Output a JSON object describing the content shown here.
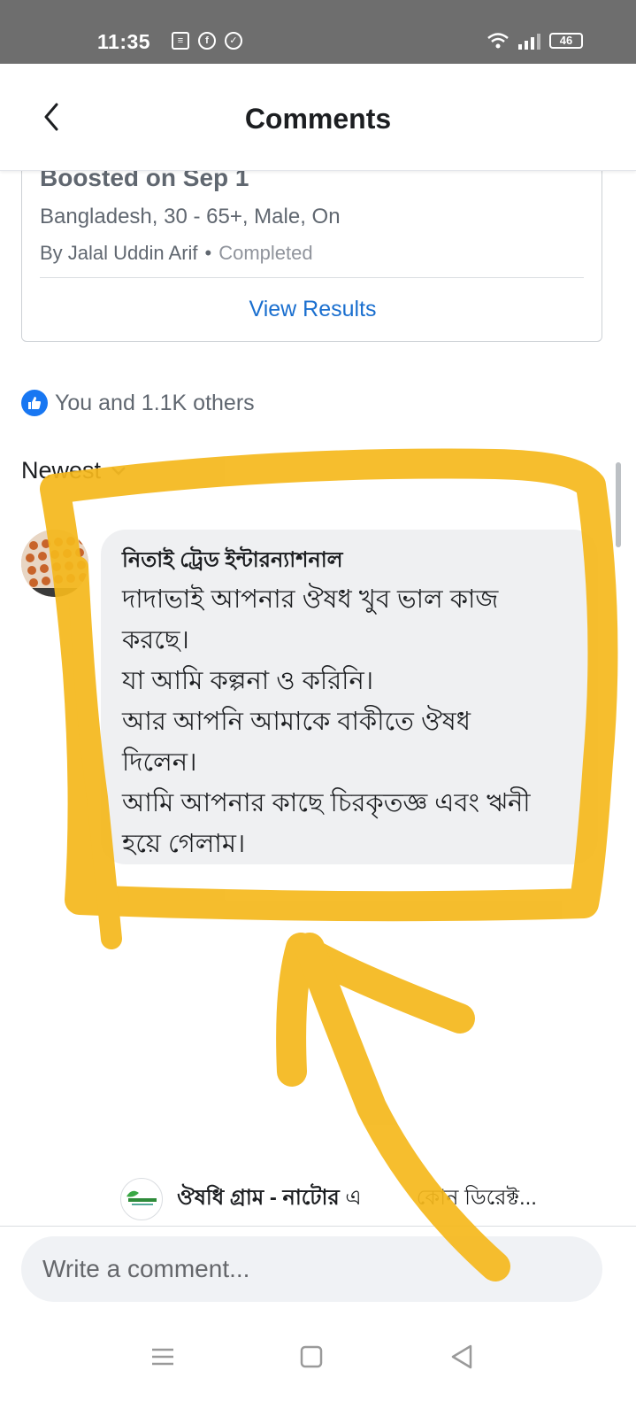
{
  "status_bar": {
    "time": "11:35",
    "battery": "46"
  },
  "header": {
    "title": "Comments"
  },
  "boost": {
    "title": "Boosted on Sep 1",
    "audience": "Bangladesh, 30 - 65+, Male, On",
    "author": "By Jalal Uddin Arif",
    "separator": "•",
    "status": "Completed",
    "action": "View Results"
  },
  "reactions": {
    "summary": "You and 1.1K others"
  },
  "sort": {
    "label": "Newest"
  },
  "comment": {
    "author": "নিতাই ট্রেড ইন্টারন্যাশনাল",
    "text": "দাদাভাই আপনার ঔষধ খুব ভাল কাজ\nকরছে।\nযা আমি কল্পনা ও করিনি।\nআর আপনি আমাকে বাকীতে ঔষধ\nদিলেন।\nআমি আপনার কাছে চিরকৃতজ্ঞ এবং ঋনী\nহয়ে গেলাম।"
  },
  "reply_preview": {
    "page_name": "ঔষধি গ্রাম - নাটোর",
    "snippet_start": " এ",
    "snippet_end": "কোন ডিরেক্ট..."
  },
  "composer": {
    "placeholder": "Write a comment..."
  },
  "colors": {
    "link_blue": "#1a6fcf",
    "like_blue": "#1877f2",
    "highlight_yellow": "#f5b81c",
    "status_bar": "#6e6e6e"
  },
  "icons": [
    "back-arrow-icon",
    "like-icon",
    "chevron-down-icon",
    "menu-icon",
    "home-square-icon",
    "back-triangle-icon"
  ]
}
